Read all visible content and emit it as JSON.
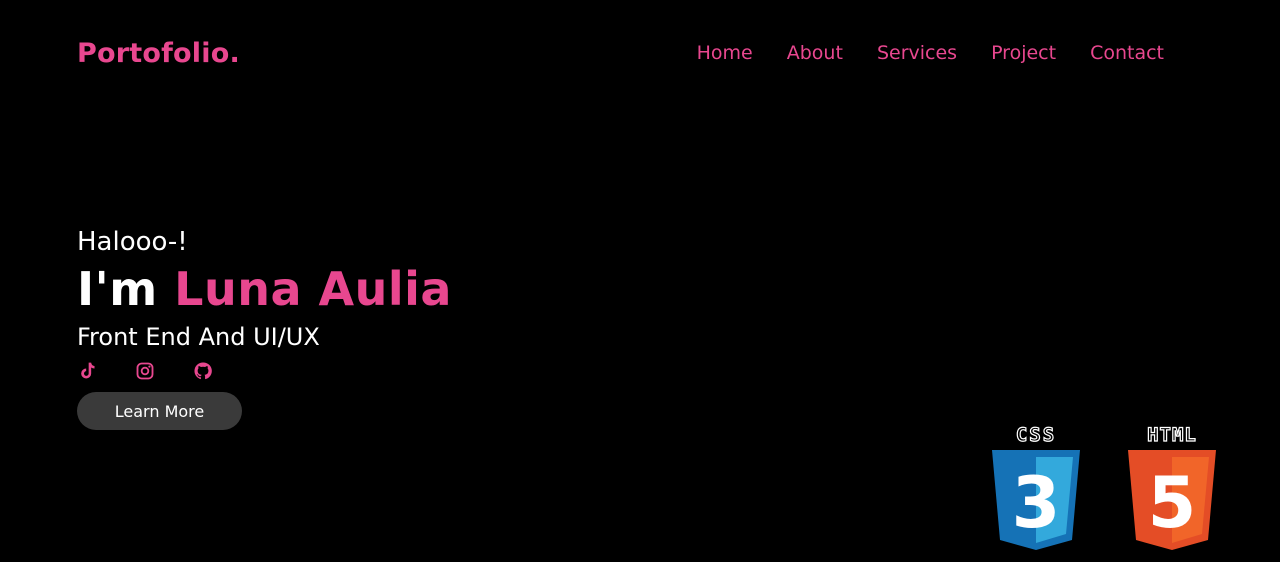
{
  "header": {
    "logo": "Portofolio.",
    "nav": [
      "Home",
      "About",
      "Services",
      "Project",
      "Contact"
    ]
  },
  "hero": {
    "greeting": "Halooo-!",
    "intro": "I'm ",
    "name": "Luna Aulia",
    "role": "Front End And UI/UX",
    "socials": [
      "tiktok-icon",
      "instagram-icon",
      "github-icon"
    ],
    "button_label": "Learn More"
  },
  "badges": {
    "css_label": "CSS",
    "css_number": "3",
    "html_label": "HTML",
    "html_number": "5"
  },
  "colors": {
    "accent": "#e8478f",
    "background": "#000000",
    "button": "#3a3a3a",
    "css_blue": "#2965f1",
    "html_orange": "#e44d26"
  }
}
